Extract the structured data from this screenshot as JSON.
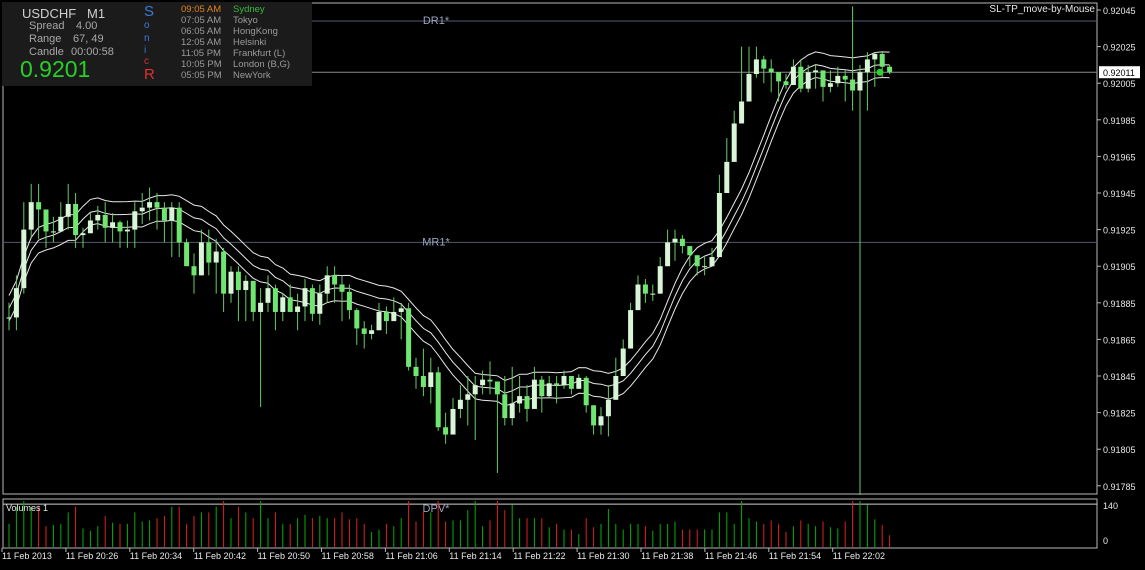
{
  "info": {
    "symbol": "USDCHF",
    "timeframe": "M1",
    "spread_label": "Spread",
    "spread_value": "4.00",
    "range_label": "Range",
    "range_value": "67, 49",
    "candle_label": "Candle",
    "candle_value": "00:00:58",
    "price": "0.9201",
    "sonic_letters": [
      "S",
      "o",
      "n",
      "i",
      "c",
      "R"
    ],
    "sessions": [
      {
        "time": "09:05 AM",
        "city": "Sydney",
        "active": true
      },
      {
        "time": "07:05 AM",
        "city": "Tokyo",
        "active": false
      },
      {
        "time": "06:05 AM",
        "city": "HongKong",
        "active": false
      },
      {
        "time": "12:05 AM",
        "city": "Helsinki",
        "active": false
      },
      {
        "time": "11:05 PM",
        "city": "Frankfurt  (L)",
        "active": false
      },
      {
        "time": "10:05 PM",
        "city": "London  (B,G)",
        "active": false
      },
      {
        "time": "05:05 PM",
        "city": "NewYork",
        "active": false
      }
    ]
  },
  "ea_label": "SL-TP_move-by-Mouse",
  "pivots": [
    {
      "name": "DR1*",
      "price": 0.92039
    },
    {
      "name": "MR1*",
      "price": 0.91918
    },
    {
      "name": "DPV*",
      "price": 0.91775
    }
  ],
  "volume_label": "Volumes 1",
  "volume_scale": [
    "140",
    "0"
  ],
  "colors": {
    "bull": "#d8f5d8",
    "bear": "#6fe66f",
    "wick": "#66cc66",
    "band": "#e8e8e8",
    "vol_up": "#00b000",
    "vol_down": "#e02020",
    "bid_line": "#8a8a8a",
    "session_active": "#3cb83c",
    "session_time_active": "#e08020"
  },
  "chart_data": {
    "type": "candlestick",
    "price_axis_ticks": [
      "0.92045",
      "0.92025",
      "0.92005",
      "0.91985",
      "0.91965",
      "0.91945",
      "0.91925",
      "0.91905",
      "0.91885",
      "0.91865",
      "0.91845",
      "0.91825",
      "0.91805",
      "0.91785"
    ],
    "current_price": "0.92011",
    "time_labels": [
      "11 Feb 2013",
      "11 Feb 20:26",
      "11 Feb 20:34",
      "11 Feb 20:42",
      "11 Feb 20:50",
      "11 Feb 20:58",
      "11 Feb 21:06",
      "11 Feb 21:14",
      "11 Feb 21:22",
      "11 Feb 21:30",
      "11 Feb 21:38",
      "11 Feb 21:46",
      "11 Feb 21:54",
      "11 Feb 22:02"
    ],
    "closes": [
      0.91877,
      0.91893,
      0.91925,
      0.9194,
      0.91936,
      0.91924,
      0.91924,
      0.91932,
      0.91939,
      0.91922,
      0.91923,
      0.9193,
      0.91933,
      0.91926,
      0.91929,
      0.91924,
      0.91925,
      0.91935,
      0.91937,
      0.9194,
      0.91937,
      0.9193,
      0.91937,
      0.91918,
      0.91905,
      0.919,
      0.91918,
      0.91907,
      0.91913,
      0.9189,
      0.91902,
      0.91892,
      0.91897,
      0.9188,
      0.91885,
      0.91893,
      0.9188,
      0.91888,
      0.9188,
      0.91883,
      0.91893,
      0.91879,
      0.9189,
      0.919,
      0.91895,
      0.91891,
      0.91881,
      0.91871,
      0.91868,
      0.9187,
      0.9188,
      0.91875,
      0.9188,
      0.91882,
      0.9185,
      0.91845,
      0.91839,
      0.91847,
      0.91817,
      0.91813,
      0.91827,
      0.91832,
      0.91835,
      0.9184,
      0.91843,
      0.91842,
      0.91835,
      0.91822,
      0.9183,
      0.91834,
      0.91827,
      0.91843,
      0.91834,
      0.91841,
      0.9184,
      0.91845,
      0.91838,
      0.91844,
      0.91829,
      0.91818,
      0.91823,
      0.91832,
      0.91845,
      0.9186,
      0.91881,
      0.91895,
      0.9189,
      0.9189,
      0.91905,
      0.91918,
      0.9192,
      0.91916,
      0.91911,
      0.91905,
      0.91905,
      0.9191,
      0.91945,
      0.91962,
      0.91983,
      0.91995,
      0.9201,
      0.92018,
      0.92013,
      0.92011,
      0.92006,
      0.92004,
      0.92014,
      0.92002,
      0.92011,
      0.92012,
      0.92003,
      0.92005,
      0.92009,
      0.92007,
      0.92001,
      0.92011,
      0.92018,
      0.92021,
      0.92014,
      0.92011
    ],
    "highs": [
      0.91885,
      0.919,
      0.9194,
      0.9195,
      0.9195,
      0.91928,
      0.91932,
      0.9194,
      0.9195,
      0.91945,
      0.91926,
      0.91934,
      0.91938,
      0.9194,
      0.91934,
      0.9193,
      0.9193,
      0.9194,
      0.91945,
      0.91948,
      0.91945,
      0.9194,
      0.9194,
      0.9194,
      0.9192,
      0.91912,
      0.91925,
      0.91925,
      0.9192,
      0.91915,
      0.91905,
      0.91905,
      0.919,
      0.91895,
      0.91893,
      0.919,
      0.91895,
      0.9189,
      0.91895,
      0.9189,
      0.91898,
      0.91895,
      0.91895,
      0.91905,
      0.91905,
      0.919,
      0.91895,
      0.91882,
      0.91875,
      0.91873,
      0.91885,
      0.91883,
      0.91888,
      0.91885,
      0.91885,
      0.91855,
      0.9186,
      0.91855,
      0.9185,
      0.91825,
      0.91833,
      0.9184,
      0.91845,
      0.91845,
      0.91848,
      0.91853,
      0.9184,
      0.91845,
      0.9185,
      0.91845,
      0.9184,
      0.9185,
      0.91845,
      0.91845,
      0.91845,
      0.91848,
      0.91845,
      0.91846,
      0.91845,
      0.91825,
      0.91828,
      0.9184,
      0.91855,
      0.91865,
      0.91885,
      0.919,
      0.91898,
      0.91895,
      0.9191,
      0.91925,
      0.91925,
      0.91922,
      0.91915,
      0.9191,
      0.9191,
      0.91915,
      0.91955,
      0.91975,
      0.9199,
      0.92025,
      0.92025,
      0.92025,
      0.9202,
      0.92018,
      0.9201,
      0.9201,
      0.92018,
      0.92018,
      0.92015,
      0.92015,
      0.92012,
      0.92012,
      0.92014,
      0.92012,
      0.92047,
      0.92015,
      0.92022,
      0.92022,
      0.92022,
      0.92015
    ],
    "lows": [
      0.9187,
      0.9187,
      0.9189,
      0.9192,
      0.9192,
      0.91915,
      0.91918,
      0.91925,
      0.91925,
      0.91915,
      0.91915,
      0.91925,
      0.91925,
      0.91918,
      0.91918,
      0.91915,
      0.91915,
      0.91915,
      0.91928,
      0.9193,
      0.91925,
      0.91918,
      0.9191,
      0.9191,
      0.91905,
      0.9189,
      0.919,
      0.919,
      0.9189,
      0.9188,
      0.91885,
      0.91875,
      0.91875,
      0.91875,
      0.91828,
      0.9188,
      0.9187,
      0.91875,
      0.9188,
      0.9187,
      0.91875,
      0.91875,
      0.91873,
      0.91885,
      0.91885,
      0.91875,
      0.91876,
      0.91862,
      0.9186,
      0.91865,
      0.91875,
      0.91868,
      0.91875,
      0.91865,
      0.91848,
      0.91838,
      0.91834,
      0.9183,
      0.91815,
      0.91808,
      0.91815,
      0.91822,
      0.91818,
      0.9181,
      0.91835,
      0.91835,
      0.91792,
      0.91818,
      0.91818,
      0.91825,
      0.9182,
      0.9183,
      0.91825,
      0.91833,
      0.9183,
      0.91838,
      0.91835,
      0.9184,
      0.91825,
      0.91813,
      0.91813,
      0.91812,
      0.9184,
      0.91855,
      0.9187,
      0.91885,
      0.91885,
      0.91886,
      0.91895,
      0.9191,
      0.91908,
      0.91912,
      0.91905,
      0.919,
      0.919,
      0.91905,
      0.9193,
      0.9195,
      0.91975,
      0.91985,
      0.92005,
      0.92008,
      0.92005,
      0.92,
      0.91995,
      0.92002,
      0.92005,
      0.92,
      0.92,
      0.92002,
      0.91995,
      0.92,
      0.92003,
      0.91995,
      0.9199,
      0.9178,
      0.9199,
      0.92003,
      0.92008,
      0.9201
    ]
  }
}
